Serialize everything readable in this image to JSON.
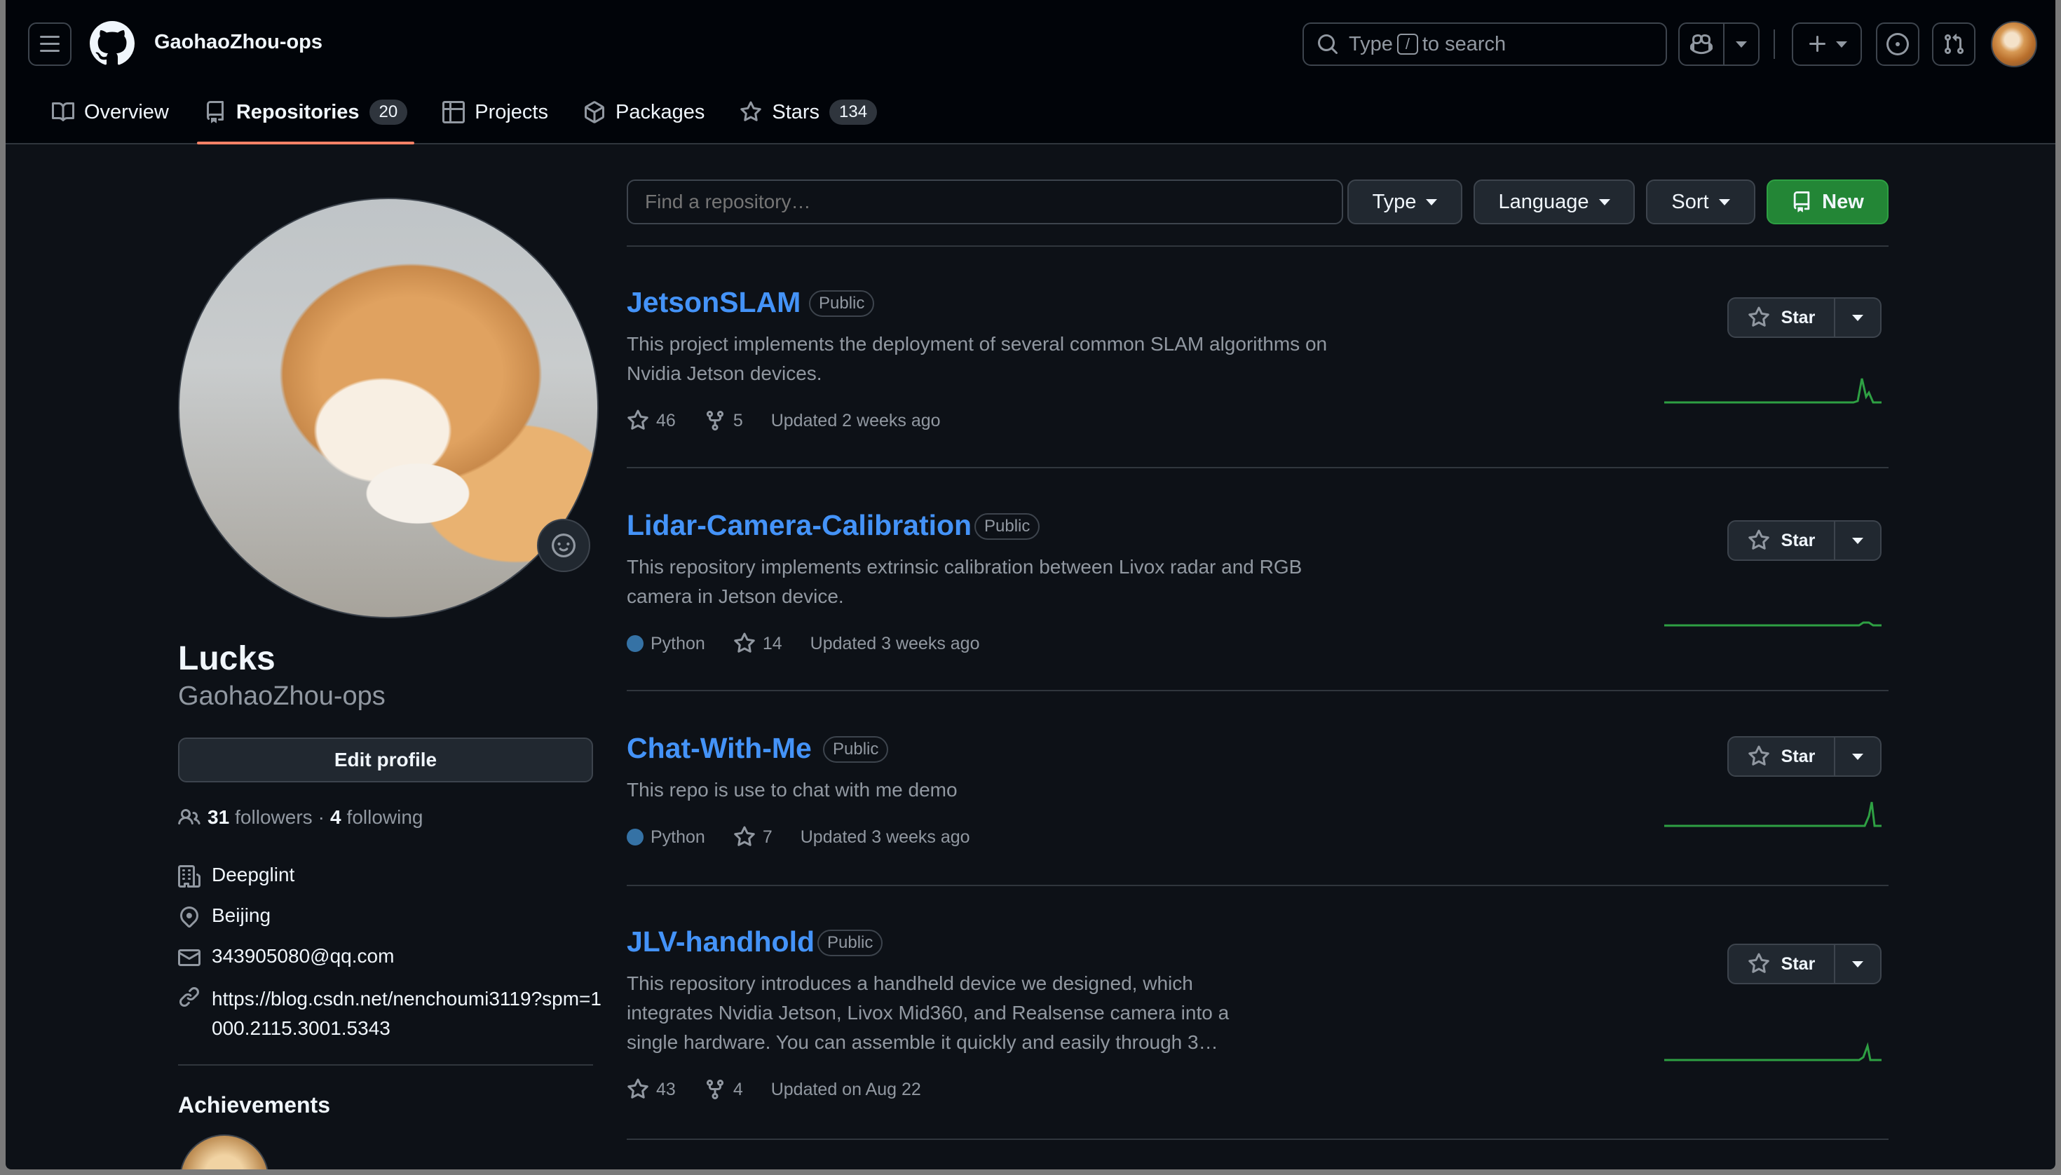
{
  "header": {
    "owner": "GaohaoZhou-ops",
    "search_prefix": "Type",
    "search_key": "/",
    "search_suffix": "to search"
  },
  "tabs": [
    {
      "label": "Overview"
    },
    {
      "label": "Repositories",
      "count": "20"
    },
    {
      "label": "Projects"
    },
    {
      "label": "Packages"
    },
    {
      "label": "Stars",
      "count": "134"
    }
  ],
  "profile": {
    "name": "Lucks",
    "login": "GaohaoZhou-ops",
    "edit_label": "Edit profile",
    "followers": "31",
    "followers_label": "followers",
    "sep": "·",
    "following": "4",
    "following_label": "following",
    "company": "Deepglint",
    "location": "Beijing",
    "email": "343905080@qq.com",
    "website": "https://blog.csdn.net/nenchoumi3119?spm=1000.2115.3001.5343",
    "achievements_label": "Achievements"
  },
  "filters": {
    "find_placeholder": "Find a repository…",
    "type": "Type",
    "language": "Language",
    "sort": "Sort",
    "new": "New"
  },
  "repos": [
    {
      "name": "JetsonSLAM",
      "visibility": "Public",
      "description": "This project implements the deployment of several common SLAM algorithms on Nvidia Jetson devices.",
      "language": "",
      "stars": "46",
      "forks": "5",
      "updated": "Updated 2 weeks ago",
      "star_label": "Star"
    },
    {
      "name": "Lidar-Camera-Calibration",
      "visibility": "Public",
      "description": "This repository implements extrinsic calibration between Livox radar and RGB camera in Jetson device.",
      "language": "Python",
      "stars": "14",
      "forks": "",
      "updated": "Updated 3 weeks ago",
      "star_label": "Star"
    },
    {
      "name": "Chat-With-Me",
      "visibility": "Public",
      "description": "This repo is use to chat with me demo",
      "language": "Python",
      "stars": "7",
      "forks": "",
      "updated": "Updated 3 weeks ago",
      "star_label": "Star"
    },
    {
      "name": "JLV-handhold",
      "visibility": "Public",
      "description": "This repository introduces a handheld device we designed, which integrates Nvidia Jetson, Livox Mid360, and Realsense camera into a single hardware. You can assemble it quickly and easily through 3…",
      "language": "",
      "stars": "43",
      "forks": "4",
      "updated": "Updated on Aug 22",
      "star_label": "Star"
    }
  ],
  "colors": {
    "bg": "#0d1117",
    "header_bg": "#010409",
    "link": "#4493f8",
    "accent_tab": "#f78166",
    "new_button": "#238636",
    "python": "#3572A5",
    "sparkline": "#2ea043"
  }
}
